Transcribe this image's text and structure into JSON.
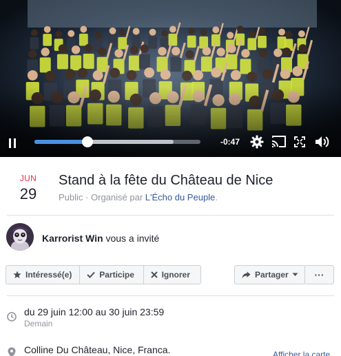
{
  "video": {
    "time_remaining": "-0:47",
    "progress": 0.32,
    "buffered": 0.84
  },
  "event": {
    "month": "JUN",
    "day": "29",
    "title": "Stand à la fête du Château de Nice",
    "privacy": "Public",
    "organized_by": "Organisé par",
    "organizer": "L'Écho du Peuple",
    "period": "."
  },
  "invite": {
    "inviter": "Karrorist Win",
    "text": "vous a invité"
  },
  "actions": {
    "interested": "Intéressé(e)",
    "going": "Participe",
    "ignore": "Ignorer",
    "share": "Partager",
    "more": "···"
  },
  "details": {
    "datetime": "du 29 juin 12:00 au 30 juin 23:59",
    "relative": "Demain",
    "location": "Colline Du Château, Nice, Franca.",
    "map_link": "Afficher la carte"
  },
  "colors": {
    "link": "#365899",
    "month": "#f02849",
    "progress": "#4a90e2"
  }
}
